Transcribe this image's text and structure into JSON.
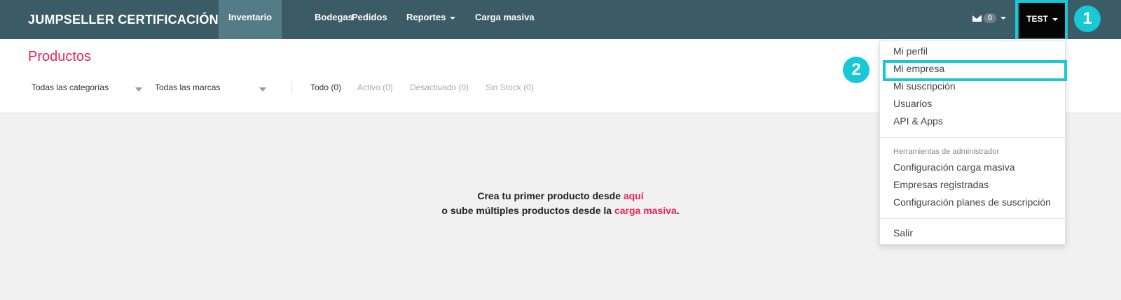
{
  "navbar": {
    "brand": "JUMPSELLER CERTIFICACIÓN",
    "items": [
      "Inventario",
      "Bodegas",
      "Pedidos",
      "Reportes",
      "Carga masiva"
    ],
    "messages_count": "0",
    "user_label": "TEST"
  },
  "annotations": {
    "step1": "1",
    "step2": "2"
  },
  "page": {
    "title": "Productos"
  },
  "filters": {
    "category": "Todas las categorías",
    "brand": "Todas las marcas",
    "tabs": [
      "Todo (0)",
      "Activo (0)",
      "Desactivado (0)",
      "Sin Stock (0)"
    ]
  },
  "empty_state": {
    "line1_text": "Crea tu primer producto desde ",
    "line1_link": "aquí",
    "line2_text": "o sube múltiples productos desde la ",
    "line2_link": "carga masiva",
    "line2_end": "."
  },
  "user_menu": {
    "items": [
      "Mi perfil",
      "Mi empresa",
      "Mi suscripción",
      "Usuarios",
      "API & Apps"
    ],
    "admin_header": "Herramientas de administrador",
    "admin_items": [
      "Configuración carga masiva",
      "Empresas registradas",
      "Configuración planes de suscripción"
    ],
    "logout": "Salir"
  },
  "colors": {
    "navbar": "#3b5b66",
    "accent": "#e8245a",
    "highlight": "#18c8d4"
  }
}
